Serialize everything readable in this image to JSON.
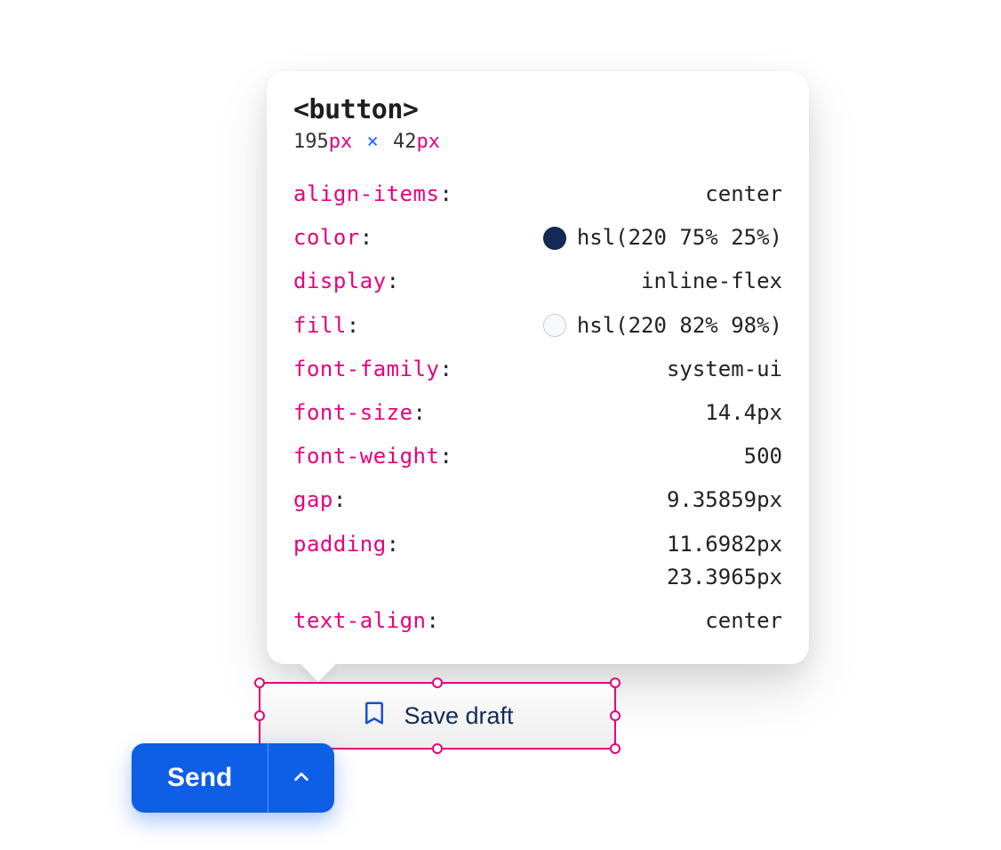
{
  "inspector": {
    "tag_label": "<button>",
    "dims": {
      "width_num": "195",
      "width_unit": "px",
      "sep": "×",
      "height_num": "42",
      "height_unit": "px"
    },
    "props": {
      "align_items": {
        "name": "align-items",
        "value": "center"
      },
      "color": {
        "name": "color",
        "value": "hsl(220 75% 25%)",
        "swatch": "#132a57"
      },
      "display": {
        "name": "display",
        "value": "inline-flex"
      },
      "fill": {
        "name": "fill",
        "value": "hsl(220 82% 98%)",
        "swatch": "#f6f9fe"
      },
      "font_family": {
        "name": "font-family",
        "value": "system-ui"
      },
      "font_size": {
        "name": "font-size",
        "value": "14.4px"
      },
      "font_weight": {
        "name": "font-weight",
        "value": "500"
      },
      "gap": {
        "name": "gap",
        "value": "9.35859px"
      },
      "padding": {
        "name": "padding",
        "value1": "11.6982px",
        "value2": "23.3965px"
      },
      "text_align": {
        "name": "text-align",
        "value": "center"
      }
    }
  },
  "buttons": {
    "save_draft": "Save draft",
    "send": "Send"
  },
  "colors": {
    "pink": "#e6007e",
    "blue": "#0e5ee6"
  }
}
